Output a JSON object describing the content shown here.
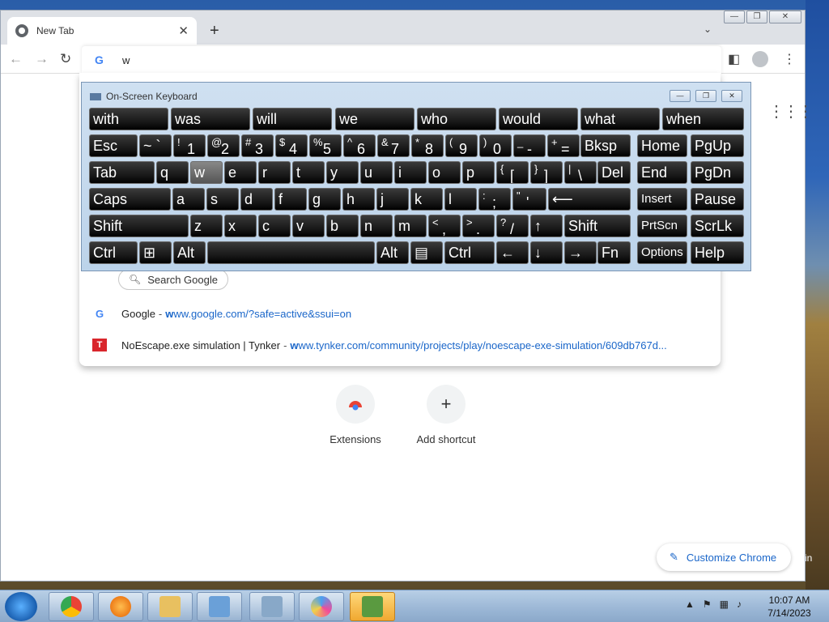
{
  "window": {
    "tab_title": "New Tab",
    "controls": [
      "—",
      "❐",
      "✕"
    ]
  },
  "toolbar": {
    "omnibox_value": "w"
  },
  "dropdown": {
    "search_chip": "Search Google",
    "suggestions": [
      {
        "title": "Google",
        "url_bold": "w",
        "url_rest": "ww.google.com/?safe=active&ssui=on"
      },
      {
        "title": "NoEscape.exe simulation | Tynker",
        "url_bold": "w",
        "url_rest": "ww.tynker.com/community/projects/play/noescape-exe-simulation/609db767d..."
      }
    ]
  },
  "ntp": {
    "shortcuts": [
      {
        "label": "Extensions"
      },
      {
        "label": "Add shortcut",
        "glyph": "+"
      }
    ],
    "customize_label": "Customize Chrome"
  },
  "osk": {
    "title": "On-Screen Keyboard",
    "predictions": [
      "with",
      "was",
      "will",
      "we",
      "who",
      "would",
      "what",
      "when"
    ],
    "row1": [
      "Esc",
      "~ `",
      "! 1",
      "@ 2",
      "# 3",
      "$ 4",
      "% 5",
      "^ 6",
      "& 7",
      "* 8",
      "( 9",
      ") 0",
      "_ -",
      "+ =",
      "Bksp",
      "Home",
      "PgUp"
    ],
    "row2": [
      "Tab",
      "q",
      "w",
      "e",
      "r",
      "t",
      "y",
      "u",
      "i",
      "o",
      "p",
      "{ [",
      "} ]",
      "| \\",
      "Del",
      "End",
      "PgDn"
    ],
    "row3": [
      "Caps",
      "a",
      "s",
      "d",
      "f",
      "g",
      "h",
      "j",
      "k",
      "l",
      ": ;",
      "\" '",
      "⟵",
      "Insert",
      "Pause"
    ],
    "row4": [
      "Shift",
      "z",
      "x",
      "c",
      "v",
      "b",
      "n",
      "m",
      "< ,",
      "> .",
      "? /",
      "↑",
      "Shift",
      "PrtScn",
      "ScrLk"
    ],
    "row5": [
      "Ctrl",
      "⊞",
      "Alt",
      "",
      "Alt",
      "▤",
      "Ctrl",
      "←",
      "↓",
      "→",
      "Fn",
      "Options",
      "Help"
    ]
  },
  "desktop": {
    "edge_label": "in"
  },
  "taskbar": {
    "time": "10:07 AM",
    "date": "7/14/2023"
  }
}
